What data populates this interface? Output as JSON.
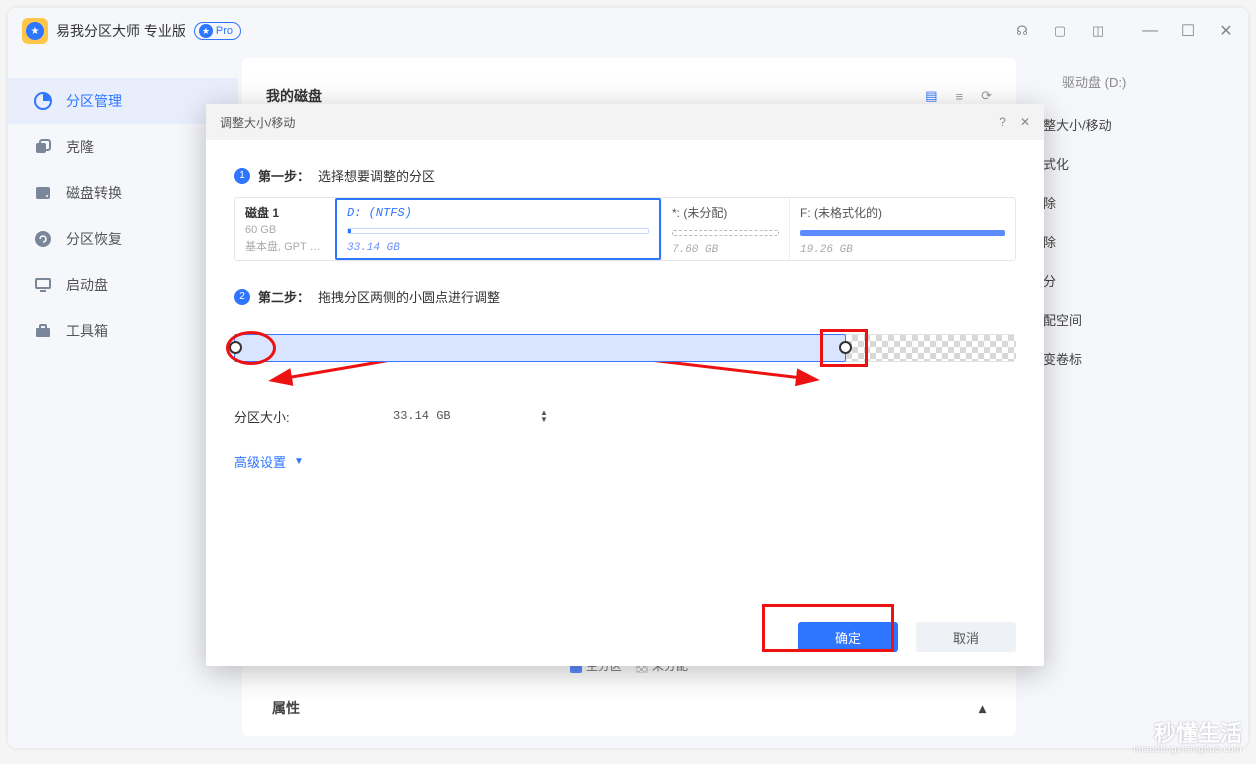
{
  "app": {
    "title": "易我分区大师 专业版",
    "badge": "Pro"
  },
  "sidebar": {
    "items": [
      {
        "label": "分区管理"
      },
      {
        "label": "克隆"
      },
      {
        "label": "磁盘转换"
      },
      {
        "label": "分区恢复"
      },
      {
        "label": "启动盘"
      },
      {
        "label": "工具箱"
      }
    ]
  },
  "panel": {
    "title": "我的磁盘",
    "props": "属性",
    "legend": {
      "primary": "主分区",
      "unalloc": "未分配"
    }
  },
  "right": {
    "drive": "驱动盘  (D:)",
    "items": [
      "调整大小/移动",
      "格式化",
      "删除",
      "擦除",
      "拆分",
      "分配空间",
      "改变卷标"
    ]
  },
  "modal": {
    "title": "调整大小/移动",
    "step1": {
      "label": "第一步：",
      "text": "选择想要调整的分区"
    },
    "disk": {
      "name": "磁盘 1",
      "size": "60 GB",
      "type": "基本盘, GPT …"
    },
    "parts": {
      "d": {
        "name": "D: (NTFS)",
        "size": "33.14 GB"
      },
      "u": {
        "name": "*: (未分配)",
        "size": "7.60 GB"
      },
      "f": {
        "name": "F: (未格式化的)",
        "size": "19.26 GB"
      }
    },
    "step2": {
      "label": "第二步：",
      "text": "拖拽分区两侧的小圆点进行调整"
    },
    "sizeLabel": "分区大小:",
    "sizeValue": "33.14 GB",
    "advanced": "高级设置",
    "ok": "确定",
    "cancel": "取消"
  },
  "watermark": {
    "big": "秒懂生活",
    "small": "miaodongshenghuo.com"
  }
}
